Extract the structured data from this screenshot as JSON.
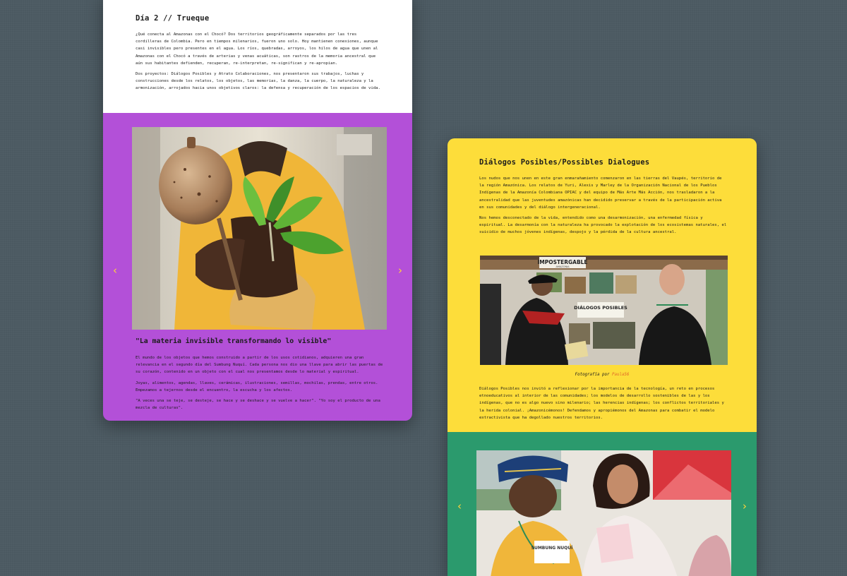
{
  "left_card": {
    "title": "Día 2 // Trueque",
    "intro_p1": "¿Qué conecta al Amazonas con el Chocó? Dos territorios geográficamente separados por las tres cordilleras de Colombia. Pero en tiempos milenarios, fueron uno solo. Hoy mantienen conexiones, aunque casi invisibles pero presentes en el agua. Los ríos, quebradas, arroyos, los hilos de agua que unen al Amazonas con el Chocó a través de arterias y venas acuáticas, son rastros de la memoria ancestral que aún sus habitantes defienden, recuperan, re-interpretan, re-significan y re-apropian.",
    "intro_p2": "Dos proyectos: Diálogos Posibles y Atrato Colaboraciones, nos presentaron sus trabajos, luchas y construcciones desde los relatos, los objetos, las memorias, la danza, la cuerpo, la naturaleza y la armonización, arrojados hacia unos objetivos claros: la defensa y recuperación de los espacios de vida.",
    "quote_title": "\"La materia invisible transformando lo visible\"",
    "purple_p1": "El mundo de los objetos que hemos construido a partir de los usos cotidianos, adquieren una gran relevancia en el segundo día del Sumbung Nuquí. Cada persona nos dio una llave para abrir las puertas de su corazón, contenido en un objeto con el cual nos presentamos desde lo material y espiritual.",
    "purple_p2": "Joyas, alimentos, agendas, llaves, cerámicas, ilustraciones, semillas, mochilas, prendas, entre otros. Empezamos a tejernos desde el encuentro, la escucha y los afectos.",
    "purple_p3": "\"A veces una se teje, se desteje, se hace y se deshace y se vuelve a hacer\". \"Yo soy el producto de una mezcla de culturas\".",
    "prev_arrow": "‹",
    "next_arrow": "›"
  },
  "right_card": {
    "title": "Diálogos Posibles/Possibles Dialogues",
    "p1": "Los nudos que nos unen en este gran enmarañamiento comenzaron en las tierras del Vaupés, territorio de la región Amazónica. Los relatos de Yuri, Alexis y Marley de la Organización Nacional de los Pueblos Indígenas de la Amazonía Colombiana OPIAC y del equipo de Más Arte Más Acción, nos trasladaron a la ancestralidad que las juventudes amazónicas han decidido preservar a través de la participación activa en sus comunidades y del diálogo intergeneracional.",
    "p2": "Nos hemos desconectado de la vida, entendido como una desarmonización, una enfermedad física y espiritual. La desarmonía con la naturaleza ha provocado la explotación de los ecosistemas naturales, el suicidio de muchos jóvenes indígenas, despojo y la pérdida de la cultura ancestral.",
    "sign_top": "IMPOSTERGABLE",
    "sign_top_sub": "AMAZONIA",
    "sign_middle": "DIÁLOGOS POSIBLES",
    "caption_prefix": "Fotografía por",
    "caption_author": "Paula56",
    "p3": "Diálogos Posibles nos invitó a reflexionar por la importancia de la tecnología, un reto en procesos etnoeducativos al interior de las comunidades; los modelos de desarrollo sostenibles de las y los indígenas, que no es algo nuevo sino milenario; las herencias indígenas; los conflictos territoriales y la herida colonial. ¡Amazonicémonos! Defendamos y apropiémonos del Amazonas para combatir el modelo extractivista que ha degollado nuestros territorios.",
    "shirt_text": "SUMBUNG NUQUÍ",
    "prev_arrow": "‹",
    "next_arrow": "›"
  },
  "colors": {
    "background": "#4b5961",
    "purple": "#b350d8",
    "yellow": "#fddd3a",
    "green": "#2b9a6d",
    "arrow": "#ffd43a",
    "link": "#e0682a"
  }
}
